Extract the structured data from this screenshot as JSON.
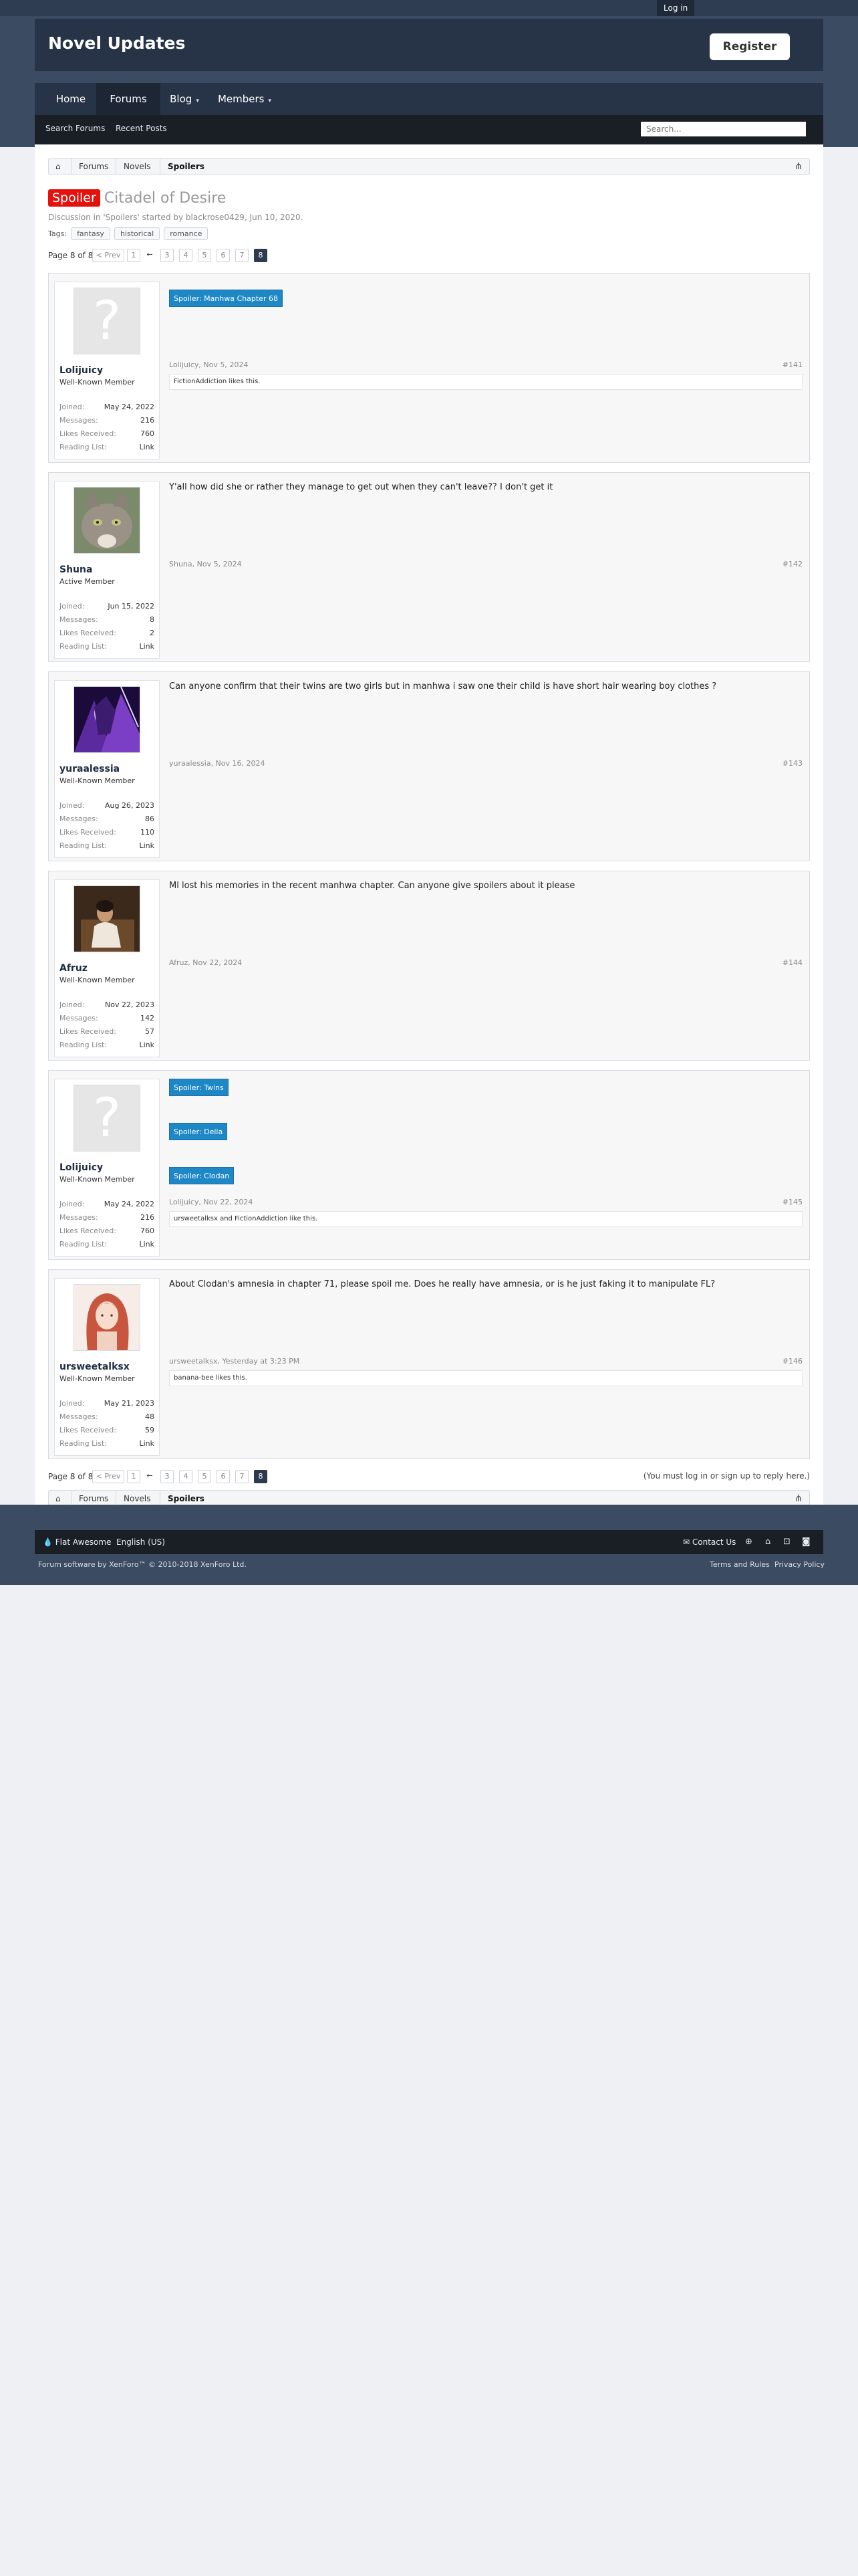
{
  "topbar": {
    "login_label": "Log in"
  },
  "header": {
    "site_title": "Novel Updates",
    "register_label": "Register"
  },
  "nav": {
    "tabs": [
      {
        "label": "Home"
      },
      {
        "label": "Forums"
      },
      {
        "label": "Blog",
        "arrow": "▾"
      },
      {
        "label": "Members",
        "arrow": "▾"
      }
    ]
  },
  "subnav": {
    "search_forums": "Search Forums",
    "recent_posts": "Recent Posts",
    "search_placeholder": "Search..."
  },
  "breadcrumb": {
    "home_icon": "⌂",
    "items": [
      "Forums",
      "Novels",
      "Spoilers"
    ],
    "sitemap_icon": "⋔"
  },
  "thread": {
    "prefix": "Spoiler",
    "title": "Citadel of Desire",
    "meta": "Discussion in 'Spoilers' started by blackrose0429, Jun 10, 2020.",
    "tags_label": "Tags:",
    "tags": [
      "fantasy",
      "historical",
      "romance"
    ]
  },
  "pagination": {
    "page_label": "Page 8 of 8",
    "prev_label": "< Prev",
    "ellipsis": "←",
    "pages": [
      "1",
      "3",
      "4",
      "5",
      "6",
      "7",
      "8"
    ],
    "current": "8",
    "reply_note": "(You must log in or sign up to reply here.)"
  },
  "posts": [
    {
      "username": "Lolijuicy",
      "title": "Well-Known Member",
      "joined": "May 24, 2022",
      "messages": "216",
      "likes": "760",
      "reading_list": "Link",
      "spoilers": [
        "Spoiler: Manhwa Chapter 68"
      ],
      "meta": "Lolijuicy, Nov 5, 2024",
      "num": "#141",
      "liked_by": "FictionAddiction likes this."
    },
    {
      "username": "Shuna",
      "title": "Active Member",
      "joined": "Jun 15, 2022",
      "messages": "8",
      "likes": "2",
      "reading_list": "Link",
      "text": "Y'all how did she or rather they manage to get out when they can't leave?? I don't get it",
      "meta": "Shuna, Nov 5, 2024",
      "num": "#142"
    },
    {
      "username": "yuraalessia",
      "title": "Well-Known Member",
      "joined": "Aug 26, 2023",
      "messages": "86",
      "likes": "110",
      "reading_list": "Link",
      "text": "Can anyone confirm that their twins are two girls but in manhwa i saw one their child is have short hair wearing boy clothes ?",
      "meta": "yuraalessia, Nov 16, 2024",
      "num": "#143"
    },
    {
      "username": "Afruz",
      "title": "Well-Known Member",
      "joined": "Nov 22, 2023",
      "messages": "142",
      "likes": "57",
      "reading_list": "Link",
      "text": "Ml lost his memories in the recent manhwa chapter. Can anyone give spoilers about it please",
      "meta": "Afruz, Nov 22, 2024",
      "num": "#144"
    },
    {
      "username": "Lolijuicy",
      "title": "Well-Known Member",
      "joined": "May 24, 2022",
      "messages": "216",
      "likes": "760",
      "reading_list": "Link",
      "spoilers": [
        "Spoiler: Twins",
        "Spoiler: Della",
        "Spoiler: Clodan"
      ],
      "meta": "Lolijuicy, Nov 22, 2024",
      "num": "#145",
      "liked_by": "ursweetalksx and FictionAddiction like this."
    },
    {
      "username": "ursweetalksx",
      "title": "Well-Known Member",
      "joined": "May 21, 2023",
      "messages": "48",
      "likes": "59",
      "reading_list": "Link",
      "text": "About Clodan's amnesia in chapter 71, please spoil me. Does he really have amnesia, or is he just faking it to manipulate FL?",
      "meta": "ursweetalksx, Yesterday at 3:23 PM",
      "num": "#146",
      "liked_by": "banana-bee likes this."
    }
  ],
  "stat_labels": {
    "joined": "Joined:",
    "messages": "Messages:",
    "likes": "Likes Received:",
    "reading_list": "Reading List:"
  },
  "footer": {
    "style_label": "Flat Awesome",
    "language_label": "English (US)",
    "contact_label": "Contact Us",
    "copyright": "Forum software by XenForo™ © 2010-2018 XenForo Ltd.",
    "terms_label": "Terms and Rules",
    "privacy_label": "Privacy Policy"
  }
}
